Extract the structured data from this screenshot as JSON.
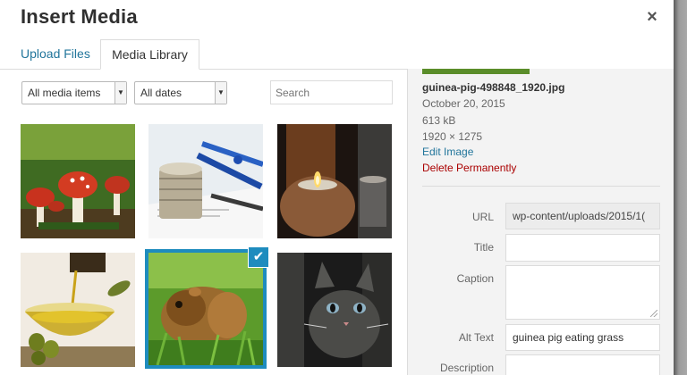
{
  "modal": {
    "title": "Insert Media",
    "close_label": "×"
  },
  "tabs": {
    "upload": "Upload Files",
    "library": "Media Library"
  },
  "filters": {
    "media_type": "All media items",
    "dates": "All dates",
    "search_placeholder": "Search",
    "dropdown_arrow": "▼"
  },
  "grid": {
    "items": [
      {
        "subject": "mushrooms"
      },
      {
        "subject": "coins and pens"
      },
      {
        "subject": "candle"
      },
      {
        "subject": "olive oil"
      },
      {
        "subject": "guinea pig",
        "selected": true
      },
      {
        "subject": "kitten"
      }
    ],
    "check_glyph": "✔"
  },
  "details": {
    "filename": "guinea-pig-498848_1920.jpg",
    "date": "October 20, 2015",
    "filesize": "613 kB",
    "dimensions": "1920 × 1275",
    "edit_link": "Edit Image",
    "delete_link": "Delete Permanently"
  },
  "fields": {
    "url_label": "URL",
    "url_value": "wp-content/uploads/2015/1(",
    "title_label": "Title",
    "title_value": "",
    "caption_label": "Caption",
    "caption_value": "",
    "alt_label": "Alt Text",
    "alt_value": "guinea pig eating grass",
    "description_label": "Description",
    "description_value": ""
  },
  "colors": {
    "accent": "#1e8cbe",
    "link": "#21759b",
    "delete": "#aa0000"
  }
}
